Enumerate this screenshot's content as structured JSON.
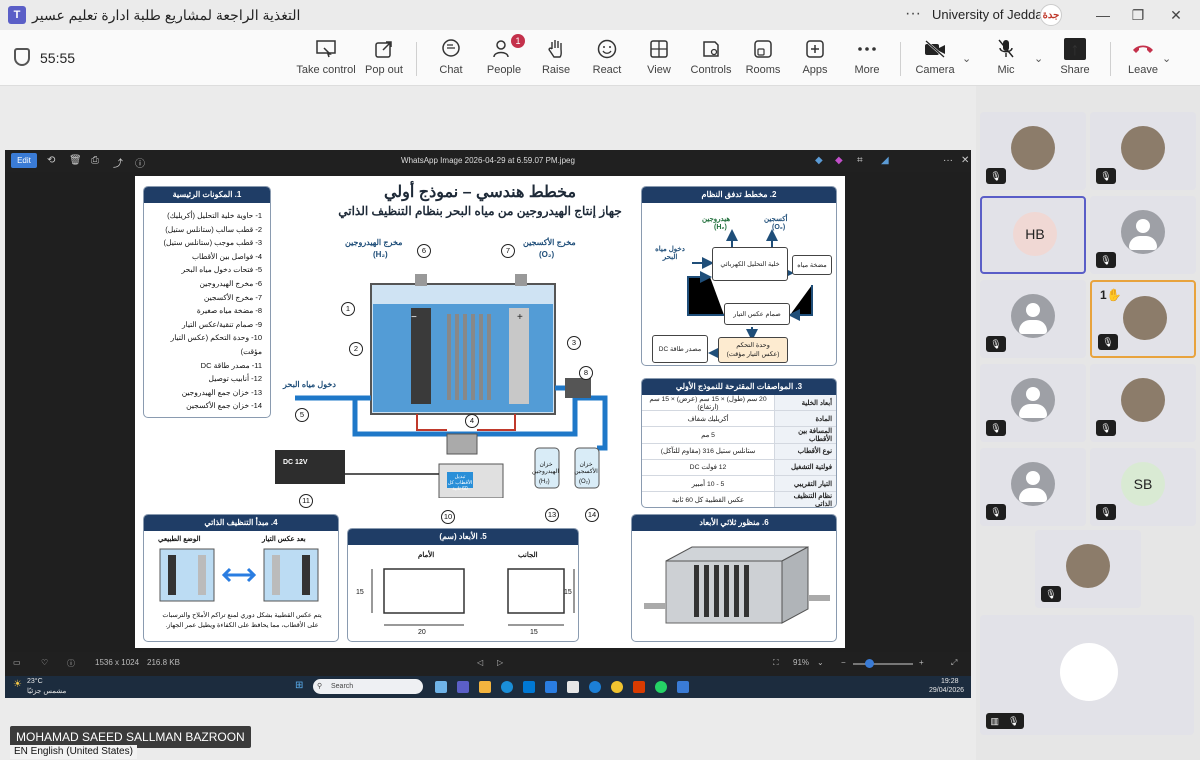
{
  "window": {
    "title": "التغذية الراجعة لمشاريع طلبة ادارة تعليم عسير",
    "org": "University of Jeddah",
    "org_logo": "جدة",
    "app_logo": "T",
    "more": "···",
    "min": "—",
    "restore": "❐",
    "close": "✕"
  },
  "toolbar": {
    "timer": "55:55",
    "take_control": "Take control",
    "pop_out": "Pop out",
    "chat": "Chat",
    "people": "People",
    "people_badge": "1",
    "raise": "Raise",
    "react": "React",
    "view": "View",
    "controls": "Controls",
    "rooms": "Rooms",
    "apps": "Apps",
    "more": "More",
    "camera": "Camera",
    "mic": "Mic",
    "share": "Share",
    "leave": "Leave",
    "colors": {
      "leave": "#c4314b",
      "accent": "#5b5fc7"
    }
  },
  "viewer": {
    "edit": "Edit",
    "filename": "WhatsApp Image 2026-04-29 at 6.59.07 PM.jpeg",
    "dimensions": "1536 x 1024",
    "filesize": "216.8 KB",
    "zoom": "91%",
    "zoom_level": 0.91
  },
  "taskbar": {
    "weather_temp": "23°C",
    "weather_desc": "مشمس جزئيًا",
    "search": "Search",
    "time": "19:28",
    "date": "29/04/2026"
  },
  "doc": {
    "title": "مخطط هندسي – نموذج أولي",
    "subtitle": "جهاز إنتاج الهيدروجين من مياه البحر بنظام التنظيف الذاتي",
    "components_title": "1. المكونات الرئيسية",
    "components": [
      "1- حاوية خلية التحليل (أكريليك)",
      "2- قطب سالب (ستانلس ستيل)",
      "3- قطب موجب (ستانلس ستيل)",
      "4- فواصل بين الأقطاب",
      "5- فتحات دخول مياه البحر",
      "6- مخرج الهيدروجين",
      "7- مخرج الأكسجين",
      "8- مضخة مياه صغيرة",
      "9- صمام تنقية/عكس التيار",
      "10- وحدة التحكم (عكس التيار مؤقت)",
      "11- مصدر طاقة DC",
      "12- أنابيب توصيل",
      "13- خزان جمع الهيدروجين",
      "14- خزان جمع الأكسجين"
    ],
    "flow_title": "2. مخطط تدفق النظام",
    "flow": {
      "h2": "هيدروجين",
      "h2f": "(H₂)",
      "o2": "أكسجين",
      "o2f": "(O₂)",
      "sea_in": "دخول مياه البحر",
      "cell": "خلية التحليل الكهربائي",
      "pump": "مضخة مياه",
      "valve": "صمام عكس التيار",
      "control": "وحدة التحكم",
      "control_sub": "(عكس التيار مؤقت)",
      "dc": "مصدر طاقة DC"
    },
    "specs_title": "3. المواصفات المقترحة للنموذج الأولي",
    "specs": [
      {
        "k": "أبعاد الخلية",
        "v": "20 سم (طول) × 15 سم (عرض) × 15 سم (ارتفاع)"
      },
      {
        "k": "المادة",
        "v": "أكريليك شفاف"
      },
      {
        "k": "المسافة بين الأقطاب",
        "v": "5 مم"
      },
      {
        "k": "نوع الأقطاب",
        "v": "ستانلس ستيل 316 (مقاوم للتآكل)"
      },
      {
        "k": "فولتية التشغيل",
        "v": "12 فولت DC"
      },
      {
        "k": "التيار التقريبي",
        "v": "5 - 10 أمبير"
      },
      {
        "k": "نظام التنظيف الذاتي",
        "v": "عكس القطبية كل 60 ثانية"
      }
    ],
    "diagram": {
      "h2_out": "مخرج الهيدروجين",
      "h2_f": "(H₂)",
      "o2_out": "مخرج الأكسجين",
      "o2_f": "(O₂)",
      "sea_in": "دخول مياه البحر",
      "dc": "DC 12V",
      "ctrl_screen": "تبديل الأقطاب كل 60 ثانية",
      "tank_h2": "خزان الهيدروجين",
      "tank_h2f": "(H₂)",
      "tank_o2": "خزان الأكسجين",
      "tank_o2f": "(O₂)",
      "minus": "−",
      "plus": "+",
      "n1": "1",
      "n2": "2",
      "n3": "3",
      "n4": "4",
      "n5": "5",
      "n6": "6",
      "n7": "7",
      "n8": "8",
      "n10": "10",
      "n11": "11",
      "n13": "13",
      "n14": "14"
    },
    "clean_title": "4. مبدأ التنظيف الذاتي",
    "clean_normal": "الوضع الطبيعي",
    "clean_after": "بعد عكس التيار",
    "clean_desc1": "يتم عكس القطبية بشكل دوري لمنع تراكم الأملاح والترسبات",
    "clean_desc2": "على الأقطاب، مما يحافظ على الكفاءة ويطيل عمر الجهاز.",
    "dims_title": "5. الأبعاد (سم)",
    "dims_front": "الأمام",
    "dims_side": "الجانب",
    "dims_w": "20",
    "dims_h": "15",
    "dims_d": "15",
    "dims_h2": "15",
    "view3d_title": "6. منظور ثلاثي الأبعاد"
  },
  "participants": [
    {
      "initials": "",
      "type": "photo",
      "mic": "🎙"
    },
    {
      "initials": "",
      "type": "photo",
      "mic": "🎙"
    },
    {
      "initials": "HB",
      "type": "initials",
      "mic": ""
    },
    {
      "initials": "",
      "type": "generic",
      "mic": "🎙"
    },
    {
      "initials": "",
      "type": "generic",
      "mic": "🎙"
    },
    {
      "initials": "",
      "type": "photo",
      "mic": "🎙",
      "hand": "1✋"
    },
    {
      "initials": "",
      "type": "generic",
      "mic": "🎙"
    },
    {
      "initials": "",
      "type": "photo",
      "mic": "🎙"
    },
    {
      "initials": "",
      "type": "generic",
      "mic": "🎙"
    },
    {
      "initials": "SB",
      "type": "initials",
      "mic": "🎙"
    },
    {
      "initials": "",
      "type": "photo",
      "mic": "🎙"
    },
    {
      "initials": "",
      "type": "photo",
      "mic": "🎙"
    }
  ],
  "presenter": {
    "name": "MOHAMAD SAEED SALLMAN BAZROON",
    "lang": "EN English (United States)"
  }
}
